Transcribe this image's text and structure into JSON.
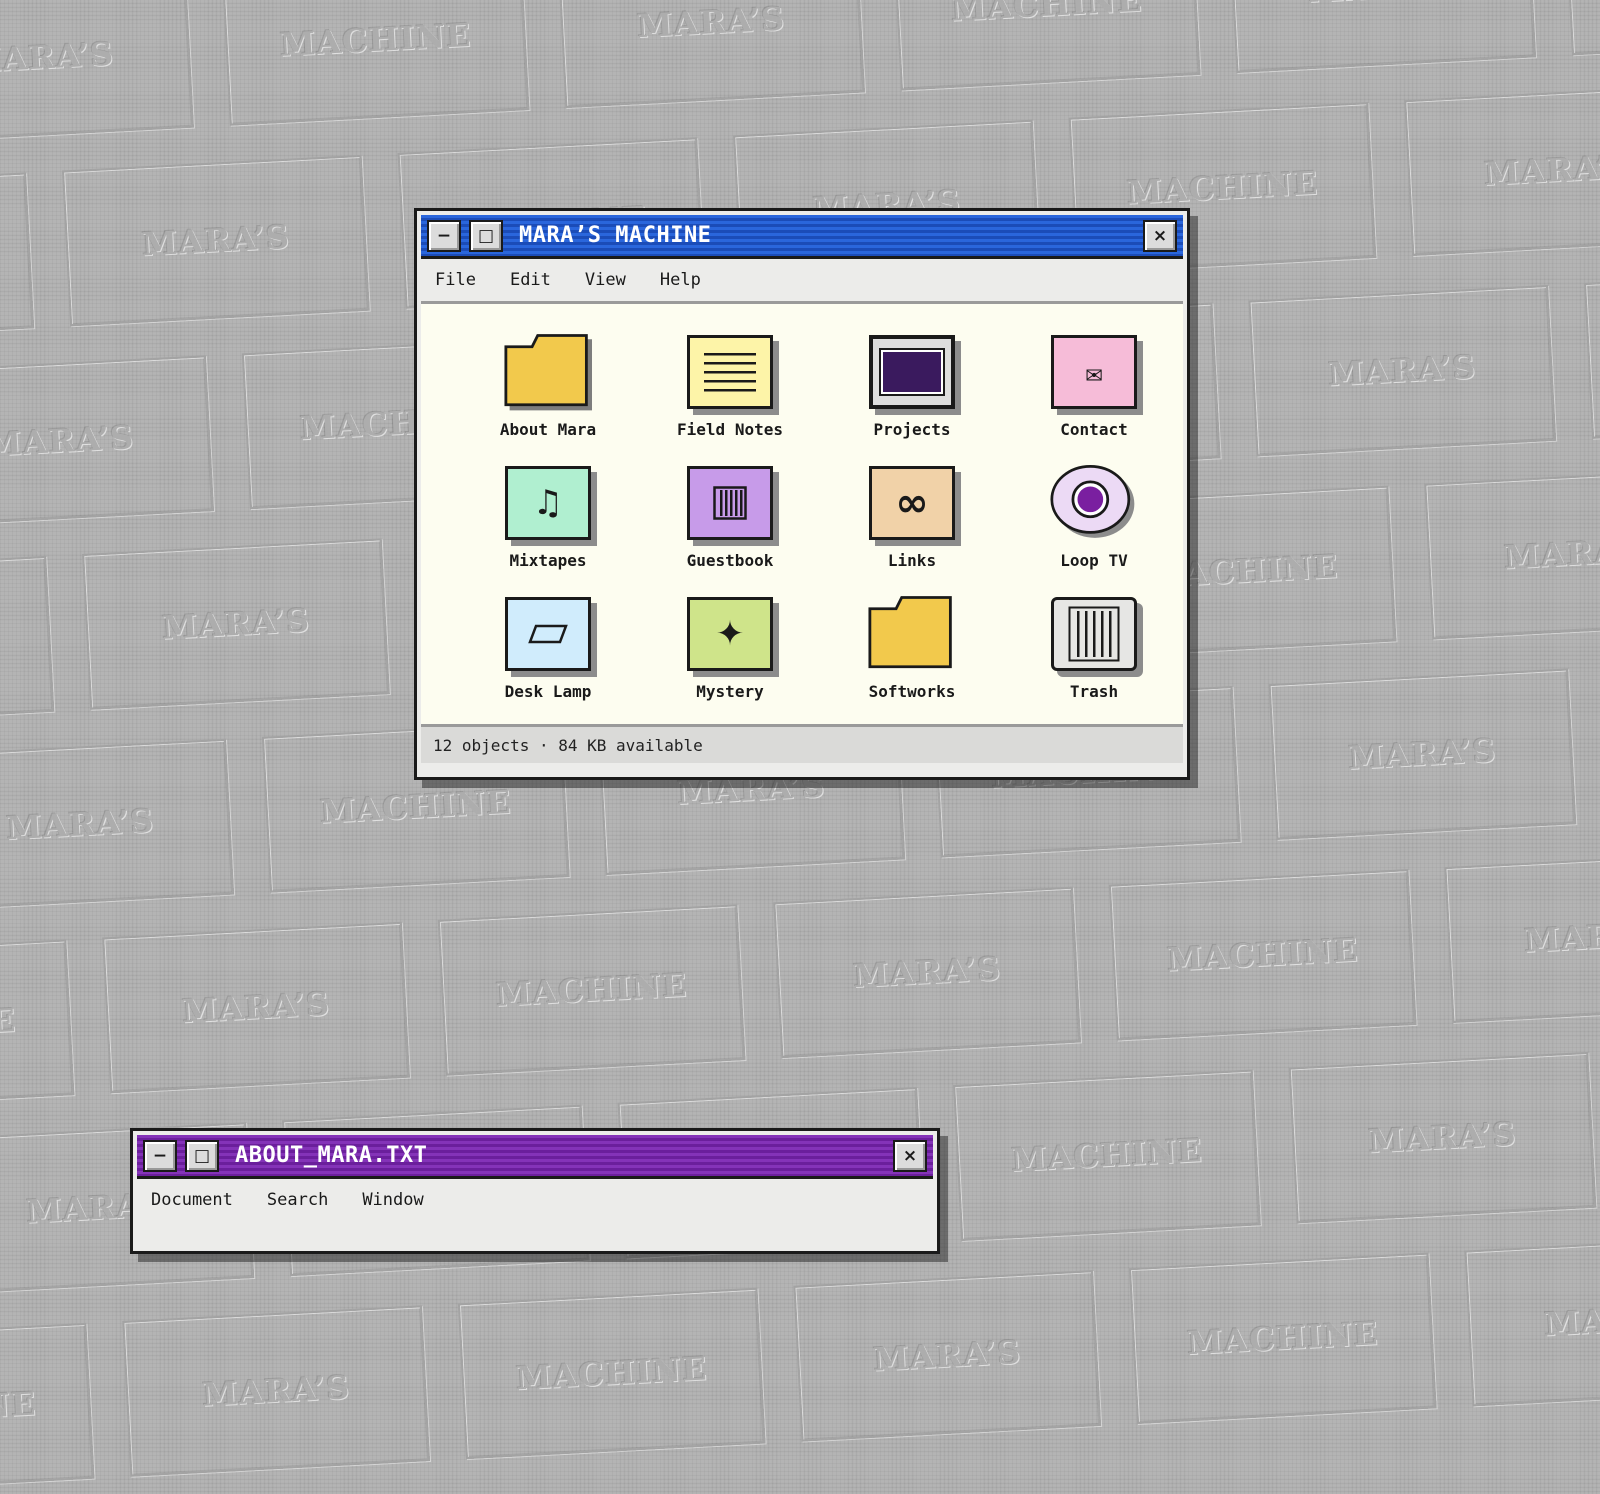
{
  "wallpaper": {
    "words": [
      "MARA’S",
      "MACHINE"
    ]
  },
  "main_window": {
    "title": "MARA’S MACHINE",
    "controls": {
      "minimize": "−",
      "maximize": "□",
      "close": "×"
    },
    "menu": [
      "File",
      "Edit",
      "View",
      "Help"
    ],
    "icons": [
      {
        "label": "About Mara",
        "icon": "folder-icon",
        "color": "#f2c94c"
      },
      {
        "label": "Field Notes",
        "icon": "notes-icon",
        "color": "#fdf4a8"
      },
      {
        "label": "Projects",
        "icon": "monitor-icon",
        "color": "#3a1a5e"
      },
      {
        "label": "Contact",
        "icon": "envelope-icon",
        "color": "#f6bcd8",
        "glyph": "✉"
      },
      {
        "label": "Mixtapes",
        "icon": "music-note-icon",
        "color": "#b0efd0",
        "glyph": "♫"
      },
      {
        "label": "Guestbook",
        "icon": "guestbook-icon",
        "color": "#c79be9"
      },
      {
        "label": "Links",
        "icon": "infinity-icon",
        "color": "#f1d2a8",
        "glyph": "∞"
      },
      {
        "label": "Loop TV",
        "icon": "disc-icon",
        "color": "#ecdaf5"
      },
      {
        "label": "Desk Lamp",
        "icon": "lamp-icon",
        "color": "#d0ecfc",
        "glyph": "▱"
      },
      {
        "label": "Mystery",
        "icon": "sparkle-icon",
        "color": "#cfe48a",
        "glyph": "✦"
      },
      {
        "label": "Softworks",
        "icon": "folder-icon",
        "color": "#f2c94c"
      },
      {
        "label": "Trash",
        "icon": "trash-icon",
        "color": "#e6e6e4"
      }
    ],
    "status": "12 objects · 84 KB available"
  },
  "second_window": {
    "title": "ABOUT_MARA.TXT",
    "controls": {
      "minimize": "−",
      "maximize": "□",
      "close": "×"
    },
    "menu": [
      "Document",
      "Search",
      "Window"
    ]
  }
}
